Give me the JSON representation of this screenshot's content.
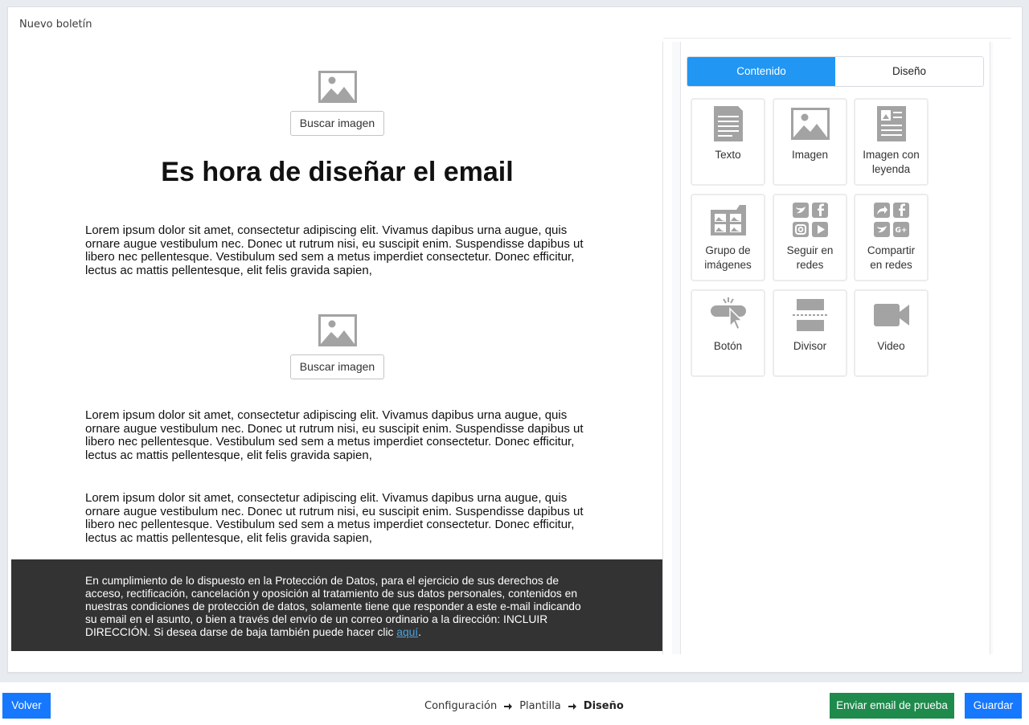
{
  "header": {
    "title": "Nuevo boletín"
  },
  "email": {
    "image_button_label": "Buscar imagen",
    "title": "Es hora de diseñar el email",
    "paragraphs": [
      "Lorem ipsum dolor sit amet, consectetur adipiscing elit. Vivamus dapibus urna augue, quis ornare augue vestibulum nec. Donec ut rutrum nisi, eu suscipit enim. Suspendisse dapibus ut libero nec pellentesque. Vestibulum sed sem a metus imperdiet consectetur. Donec efficitur, lectus ac mattis pellentesque, elit felis gravida sapien,",
      "Lorem ipsum dolor sit amet, consectetur adipiscing elit. Vivamus dapibus urna augue, quis ornare augue vestibulum nec. Donec ut rutrum nisi, eu suscipit enim. Suspendisse dapibus ut libero nec pellentesque. Vestibulum sed sem a metus imperdiet consectetur. Donec efficitur, lectus ac mattis pellentesque, elit felis gravida sapien,",
      "Lorem ipsum dolor sit amet, consectetur adipiscing elit. Vivamus dapibus urna augue, quis ornare augue vestibulum nec. Donec ut rutrum nisi, eu suscipit enim. Suspendisse dapibus ut libero nec pellentesque. Vestibulum sed sem a metus imperdiet consectetur. Donec efficitur, lectus ac mattis pellentesque, elit felis gravida sapien,"
    ],
    "footer_text": "En cumplimiento de lo dispuesto en la Protección de Datos, para el ejercicio de sus derechos de acceso, rectificación, cancelación y oposición al tratamiento de sus datos personales, contenidos en nuestras condiciones de protección de datos, solamente tiene que responder a este e-mail indicando su email en el asunto, o bien a través del envío de un correo ordinario a la dirección: INCLUIR DIRECCIÓN. Si desea darse de baja también puede hacer clic ",
    "footer_link": "aquí",
    "footer_end": "."
  },
  "panel": {
    "tabs": [
      {
        "label": "Contenido",
        "active": true
      },
      {
        "label": "Diseño",
        "active": false
      }
    ],
    "blocks": [
      {
        "label": "Texto",
        "icon": "text-doc-icon"
      },
      {
        "label": "Imagen",
        "icon": "image-icon"
      },
      {
        "label": "Imagen con leyenda",
        "icon": "image-caption-icon"
      },
      {
        "label": "Grupo de imágenes",
        "icon": "image-group-icon"
      },
      {
        "label": "Seguir en redes",
        "icon": "social-follow-icon"
      },
      {
        "label": "Compartir en redes",
        "icon": "social-share-icon"
      },
      {
        "label": "Botón",
        "icon": "button-click-icon"
      },
      {
        "label": "Divisor",
        "icon": "divider-icon"
      },
      {
        "label": "Video",
        "icon": "video-camera-icon"
      }
    ]
  },
  "footer_bar": {
    "back_label": "Volver",
    "steps": [
      "Configuración",
      "Plantilla",
      "Diseño"
    ],
    "test_label": "Enviar email de prueba",
    "save_label": "Guardar"
  },
  "colors": {
    "primary": "#1677ff",
    "tab_active": "#2196f3",
    "success": "#1e8a4c",
    "dark_footer": "#333333",
    "icon_gray": "#a3a3a3"
  }
}
